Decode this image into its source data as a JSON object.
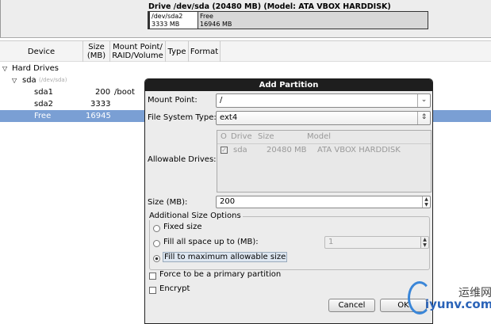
{
  "drive": {
    "title": "Drive /dev/sda (20480 MB) (Model: ATA VBOX HARDDISK)",
    "parts": [
      {
        "name": "/dev/sda2",
        "size": "3333 MB"
      },
      {
        "name": "Free",
        "size": "16946 MB"
      }
    ]
  },
  "columns": [
    "Device",
    "Size (MB)",
    "Mount Point/ RAID/Volume",
    "Type",
    "Format"
  ],
  "tree": {
    "group": "Hard Drives",
    "disk": "sda",
    "disk_path": "(/dev/sda)",
    "rows": [
      {
        "device": "sda1",
        "size": "200",
        "mount": "/boot"
      },
      {
        "device": "sda2",
        "size": "3333",
        "mount": ""
      },
      {
        "device": "Free",
        "size": "16945",
        "mount": ""
      }
    ]
  },
  "dialog": {
    "title": "Add Partition",
    "mount_label": "Mount Point:",
    "mount_value": "/",
    "fs_label": "File System Type:",
    "fs_value": "ext4",
    "drives_label": "Allowable Drives:",
    "drives_cols": [
      "O",
      "Drive",
      "Size",
      "Model"
    ],
    "drives_row": {
      "drive": "sda",
      "size": "20480 MB",
      "model": "ATA VBOX HARDDISK"
    },
    "size_label": "Size (MB):",
    "size_value": "200",
    "group_label": "Additional Size Options",
    "opt_fixed": "Fixed size",
    "opt_fill_upto": "Fill all space up to (MB):",
    "fill_upto_value": "1",
    "opt_fill_max": "Fill to maximum allowable size",
    "primary": "Force to be a primary partition",
    "encrypt": "Encrypt",
    "cancel": "Cancel",
    "ok": "OK"
  },
  "watermark": {
    "cn": "运维网",
    "url": "iyunv.com"
  }
}
